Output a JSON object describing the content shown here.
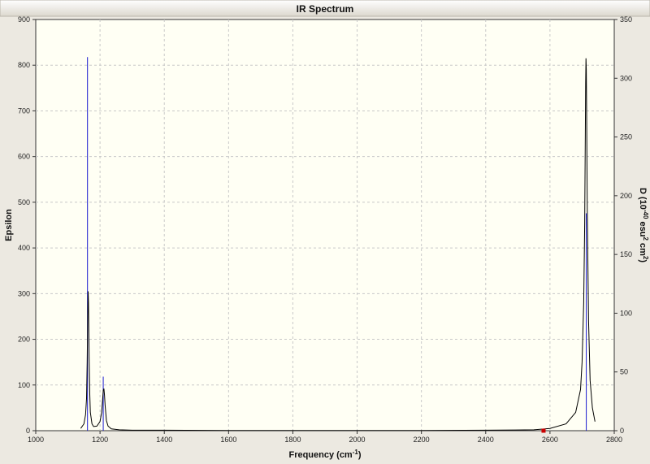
{
  "chart_data": {
    "type": "line",
    "title": "IR Spectrum",
    "xlabel": "Frequency (cm",
    "xlabel_sup": "-1",
    "xlabel_tail": ")",
    "ylabel": "Epsilon",
    "y2label_parts": [
      "D (10",
      "-40",
      " esu",
      "2",
      " cm",
      "2",
      ")"
    ],
    "xlim": [
      1000,
      2800
    ],
    "x_ticks": [
      1000,
      1200,
      1400,
      1600,
      1800,
      2000,
      2200,
      2400,
      2600,
      2800
    ],
    "ylim": [
      0,
      900
    ],
    "y_ticks": [
      0,
      100,
      200,
      300,
      400,
      500,
      600,
      700,
      800,
      900
    ],
    "y2lim": [
      0,
      350
    ],
    "y2_ticks": [
      0,
      50,
      100,
      150,
      200,
      250,
      300,
      350
    ],
    "grid": true,
    "series": [
      {
        "role": "spectrum",
        "color": "#000000",
        "x": [
          1140,
          1150,
          1155,
          1158,
          1160,
          1162,
          1163,
          1164,
          1166,
          1168,
          1170,
          1175,
          1180,
          1190,
          1200,
          1205,
          1208,
          1210,
          1212,
          1214,
          1216,
          1220,
          1225,
          1235,
          1260,
          1300,
          1400,
          1600,
          1800,
          2000,
          2200,
          2400,
          2550,
          2600,
          2650,
          2680,
          2695,
          2700,
          2705,
          2708,
          2710,
          2711,
          2712,
          2713,
          2714,
          2716,
          2720,
          2725,
          2732,
          2740
        ],
        "y": [
          5,
          15,
          35,
          70,
          150,
          270,
          305,
          280,
          160,
          80,
          40,
          15,
          9,
          10,
          20,
          40,
          68,
          88,
          92,
          78,
          55,
          22,
          10,
          4,
          2,
          1,
          1,
          0.5,
          0.5,
          0.5,
          0.5,
          1,
          2,
          5,
          15,
          40,
          90,
          150,
          280,
          450,
          650,
          760,
          815,
          790,
          700,
          480,
          240,
          110,
          50,
          20
        ]
      },
      {
        "role": "stick",
        "color": "#1a1ad0",
        "x": [
          1161,
          1210,
          2713
        ],
        "d": [
          318,
          46,
          185
        ]
      }
    ],
    "marker": {
      "x": 2580,
      "y": 0,
      "color": "#cc0000"
    }
  }
}
